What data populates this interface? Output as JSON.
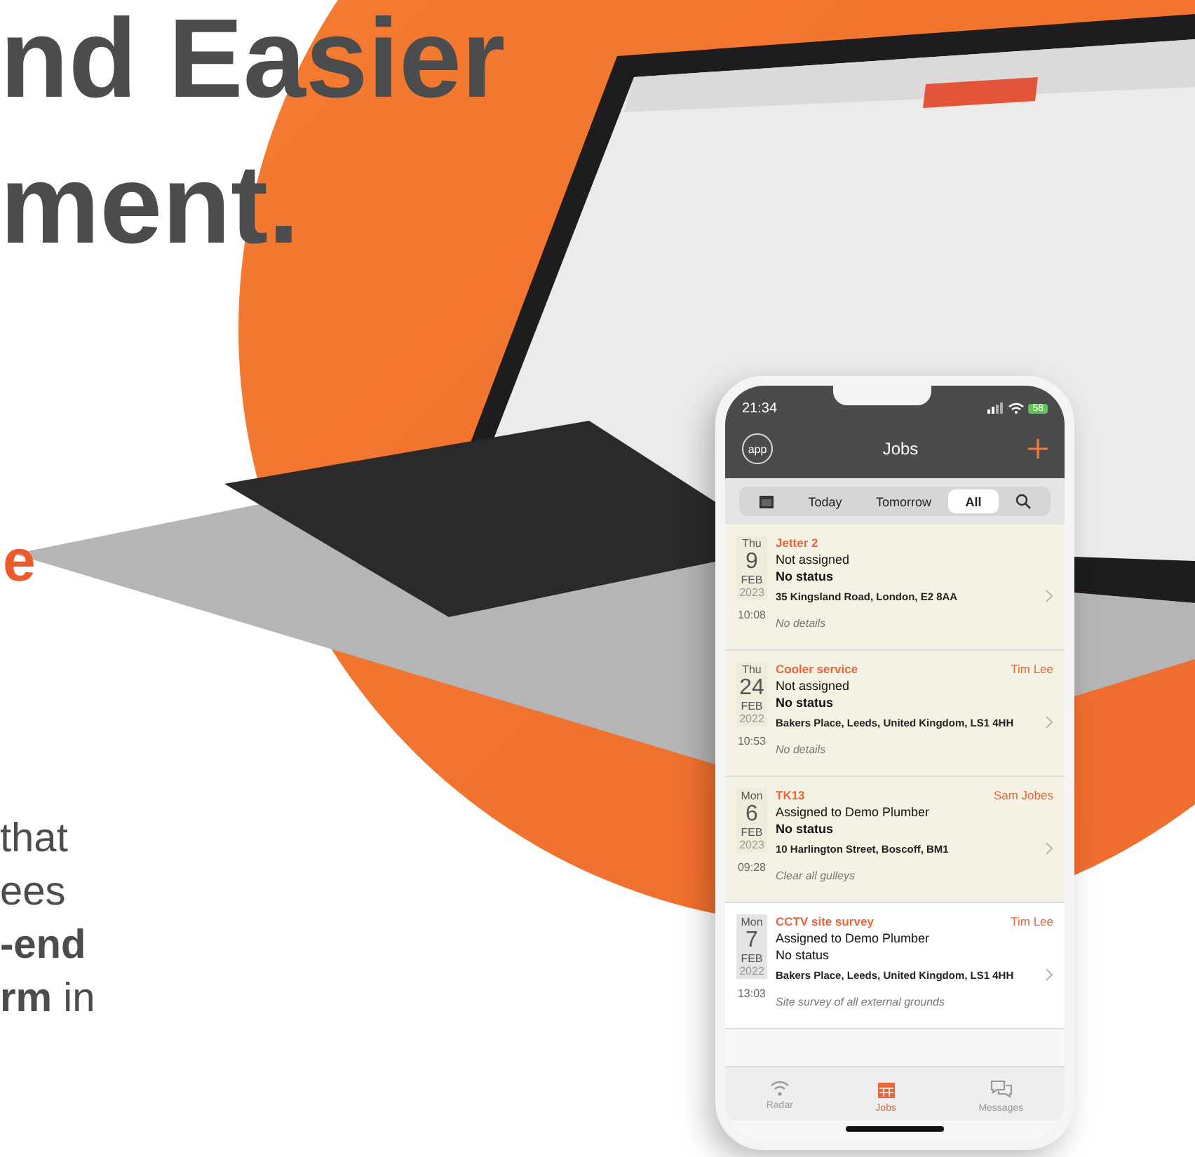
{
  "headline": {
    "lines": [
      "nd Easier",
      "ment."
    ]
  },
  "accent_letter": "e",
  "body_lines": [
    "that",
    "ees",
    "**-end**",
    "**rm** in"
  ],
  "phone": {
    "time": "21:34",
    "battery": "58",
    "logo_text": "app",
    "title": "Jobs",
    "segments": [
      {
        "kind": "calendar",
        "selected": false
      },
      {
        "kind": "text",
        "label": "Today",
        "selected": false
      },
      {
        "kind": "text",
        "label": "Tomorrow",
        "selected": false
      },
      {
        "kind": "text",
        "label": "All",
        "selected": true
      },
      {
        "kind": "search",
        "selected": false
      }
    ],
    "jobs": [
      {
        "weekday": "Thu",
        "day": "9",
        "month": "FEB",
        "year": "2023",
        "time": "10:08",
        "title": "Jetter 2",
        "assigned": "Not assigned",
        "status": "No status",
        "address": "35 Kingsland Road, London, E2 8AA",
        "details": "No details",
        "highlighted": true
      },
      {
        "weekday": "Thu",
        "day": "24",
        "month": "FEB",
        "year": "2022",
        "time": "10:53",
        "title": "Cooler service",
        "engineer": "Tim Lee",
        "assigned": "Not assigned",
        "status": "No status",
        "address": "Bakers Place, Leeds, United Kingdom, LS1 4HH",
        "details": "No details",
        "highlighted": true
      },
      {
        "weekday": "Mon",
        "day": "6",
        "month": "FEB",
        "year": "2023",
        "time": "09:28",
        "title": "TK13",
        "engineer": "Sam Jobes",
        "assigned": "Assigned to Demo Plumber",
        "status": "No status",
        "address": "10 Harlington Street, Boscoff, BM1",
        "details": "Clear all gulleys",
        "highlighted": true
      },
      {
        "weekday": "Mon",
        "day": "7",
        "month": "FEB",
        "year": "2022",
        "time": "13:03",
        "title": "CCTV site survey",
        "engineer": "Tim Lee",
        "assigned": "Assigned to Demo Plumber",
        "status": "No status",
        "address": "Bakers Place, Leeds, United Kingdom, LS1 4HH",
        "details": "Site survey of all external grounds",
        "highlighted": false
      }
    ],
    "tabs": [
      {
        "kind": "radar",
        "label": "Radar",
        "selected": false
      },
      {
        "kind": "jobs",
        "label": "Jobs",
        "selected": true
      },
      {
        "kind": "messages",
        "label": "Messages",
        "selected": false
      }
    ]
  }
}
